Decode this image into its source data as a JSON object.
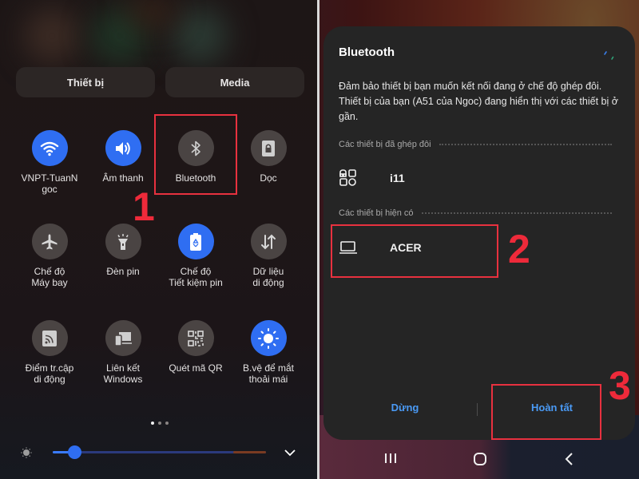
{
  "quick_panel": {
    "segments": {
      "devices": "Thiết bị",
      "media": "Media"
    },
    "tiles": [
      {
        "label": "VNPT-TuanN\ngoc",
        "icon": "wifi-icon",
        "active": true
      },
      {
        "label": "Âm thanh",
        "icon": "sound-icon",
        "active": true
      },
      {
        "label": "Bluetooth",
        "icon": "bluetooth-icon",
        "active": false
      },
      {
        "label": "Dọc",
        "icon": "portrait-lock-icon",
        "active": false
      },
      {
        "label": "Chế độ\nMáy bay",
        "icon": "airplane-icon",
        "active": false
      },
      {
        "label": "Đèn pin",
        "icon": "flashlight-icon",
        "active": false
      },
      {
        "label": "Chế độ\nTiết kiệm pin",
        "icon": "battery-saver-icon",
        "active": true
      },
      {
        "label": "Dữ liệu\ndi động",
        "icon": "mobile-data-icon",
        "active": false
      },
      {
        "label": "Điểm tr.cập\ndi động",
        "icon": "hotspot-icon",
        "active": false
      },
      {
        "label": "Liên kết\nWindows",
        "icon": "link-windows-icon",
        "active": false
      },
      {
        "label": "Quét mã QR",
        "icon": "qr-icon",
        "active": false
      },
      {
        "label": "B.vệ để mắt\nthoải mái",
        "icon": "eye-comfort-icon",
        "active": true
      }
    ],
    "page_indicator": {
      "current": 1,
      "total": 3
    },
    "brightness": {
      "level_percent": 10,
      "icon": "brightness-icon"
    }
  },
  "bluetooth_dialog": {
    "title": "Bluetooth",
    "description": "Đảm bảo thiết bị bạn muốn kết nối đang ở chế độ ghép đôi. Thiết bị của bạn (A51 của Ngoc) đang hiển thị với các thiết bị ở gần.",
    "paired_header": "Các thiết bị đã ghép đôi",
    "paired_devices": [
      {
        "name": "i11",
        "icon": "earbuds-icon"
      }
    ],
    "available_header": "Các thiết bị hiện có",
    "available_devices": [
      {
        "name": "ACER",
        "icon": "laptop-icon"
      }
    ],
    "buttons": {
      "stop": "Dừng",
      "done": "Hoàn tất"
    }
  },
  "annotations": {
    "step1": "1",
    "step2": "2",
    "step3": "3"
  },
  "colors": {
    "accent_blue": "#2f6ef2",
    "link_blue": "#4a9af5",
    "annotation_red": "#e8313f"
  }
}
